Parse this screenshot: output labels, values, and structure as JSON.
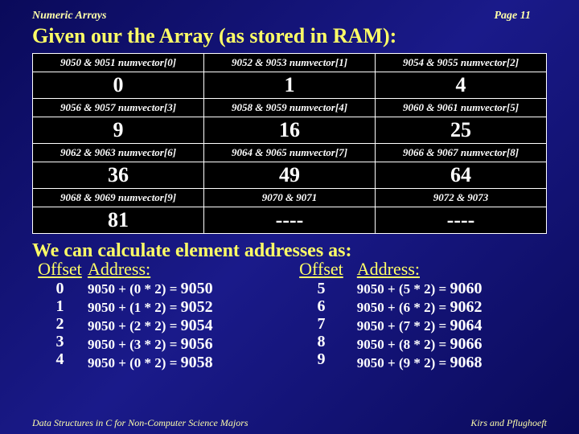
{
  "header": {
    "left": "Numeric Arrays",
    "right": "Page 11"
  },
  "title": "Given our the Array (as stored in RAM):",
  "mem": {
    "cells": [
      {
        "addr": "9050 & 9051 numvector[0]",
        "val": "0"
      },
      {
        "addr": "9052 & 9053 numvector[1]",
        "val": "1"
      },
      {
        "addr": "9054 & 9055 numvector[2]",
        "val": "4"
      },
      {
        "addr": "9056 & 9057 numvector[3]",
        "val": "9"
      },
      {
        "addr": "9058 & 9059 numvector[4]",
        "val": "16"
      },
      {
        "addr": "9060 & 9061 numvector[5]",
        "val": "25"
      },
      {
        "addr": "9062 & 9063 numvector[6]",
        "val": "36"
      },
      {
        "addr": "9064 & 9065 numvector[7]",
        "val": "49"
      },
      {
        "addr": "9066 & 9067 numvector[8]",
        "val": "64"
      },
      {
        "addr": "9068 & 9069 numvector[9]",
        "val": "81"
      },
      {
        "addr": "9070 & 9071",
        "val": "----"
      },
      {
        "addr": "9072 & 9073",
        "val": "----"
      }
    ]
  },
  "subtitle": "We can calculate element addresses as:",
  "columns": {
    "offset_hdr": "Offset",
    "address_hdr": "Address:"
  },
  "left_rows": [
    {
      "o": "0",
      "e": "9050 + (0 * 2) = ",
      "r": "9050"
    },
    {
      "o": "1",
      "e": "9050 + (1 * 2) = ",
      "r": "9052"
    },
    {
      "o": "2",
      "e": "9050 + (2 * 2) = ",
      "r": "9054"
    },
    {
      "o": "3",
      "e": "9050 + (3 * 2) = ",
      "r": "9056"
    },
    {
      "o": "4",
      "e": "9050 + (0 * 2) = ",
      "r": "9058"
    }
  ],
  "right_rows": [
    {
      "o": "5",
      "e": "9050 + (5 * 2) = ",
      "r": "9060"
    },
    {
      "o": "6",
      "e": "9050 + (6 * 2) = ",
      "r": "9062"
    },
    {
      "o": "7",
      "e": "9050 + (7 * 2) = ",
      "r": "9064"
    },
    {
      "o": "8",
      "e": "9050 + (8 * 2) = ",
      "r": "9066"
    },
    {
      "o": "9",
      "e": "9050 + (9 * 2) = ",
      "r": "9068"
    }
  ],
  "footer": {
    "left": "Data Structures in C for Non-Computer Science Majors",
    "right": "Kirs and Pflughoeft"
  }
}
